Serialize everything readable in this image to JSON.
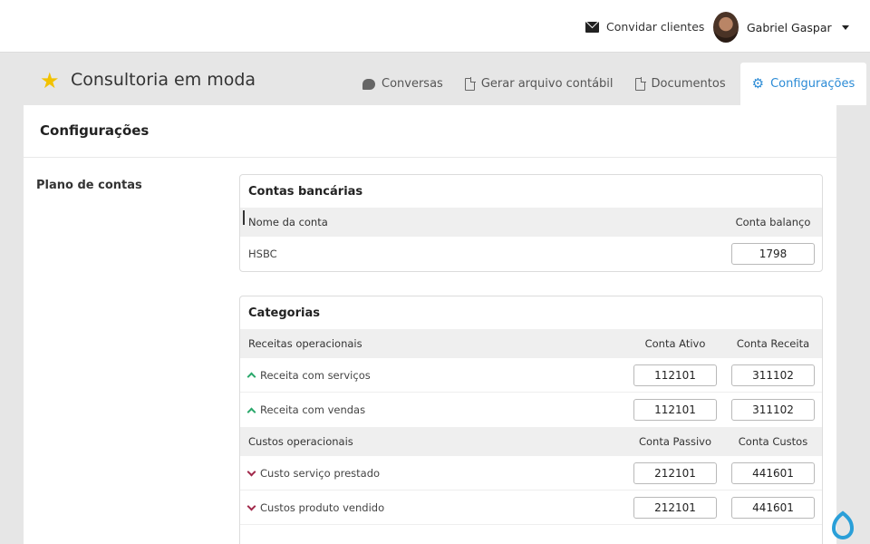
{
  "topbar": {
    "invite_label": "Convidar clientes",
    "user_name": "Gabriel Gaspar"
  },
  "header": {
    "app_title": "Consultoria em moda",
    "tabs": [
      {
        "label": "Conversas",
        "icon": "chat-icon"
      },
      {
        "label": "Gerar arquivo contábil",
        "icon": "file-export-icon"
      },
      {
        "label": "Documentos",
        "icon": "document-icon"
      },
      {
        "label": "Configurações",
        "icon": "gear-icon",
        "active": true
      }
    ]
  },
  "page": {
    "title": "Configurações",
    "section_label": "Plano de contas"
  },
  "bank_accounts": {
    "title": "Contas bancárias",
    "col_name": "Nome da conta",
    "col_balance": "Conta balanço",
    "rows": [
      {
        "name": "HSBC",
        "balance": "1798"
      }
    ]
  },
  "categories": {
    "title": "Categorias",
    "groups": [
      {
        "name": "Receitas operacionais",
        "col1": "Conta Ativo",
        "col2": "Conta Receita",
        "rows": [
          {
            "name": "Receita com serviços",
            "v1": "112101",
            "v2": "311102"
          },
          {
            "name": "Receita com vendas",
            "v1": "112101",
            "v2": "311102"
          }
        ]
      },
      {
        "name": "Custos operacionais",
        "col1": "Conta Passivo",
        "col2": "Conta Custos",
        "rows": [
          {
            "name": "Custo serviço prestado",
            "v1": "212101",
            "v2": "441601"
          },
          {
            "name": "Custos produto vendido",
            "v1": "212101",
            "v2": "441601"
          }
        ]
      }
    ]
  },
  "colors": {
    "accent": "#2b8bd6",
    "income_arrow": "#2aa86b",
    "cost_arrow": "#a1294b",
    "star": "#f2c200"
  }
}
